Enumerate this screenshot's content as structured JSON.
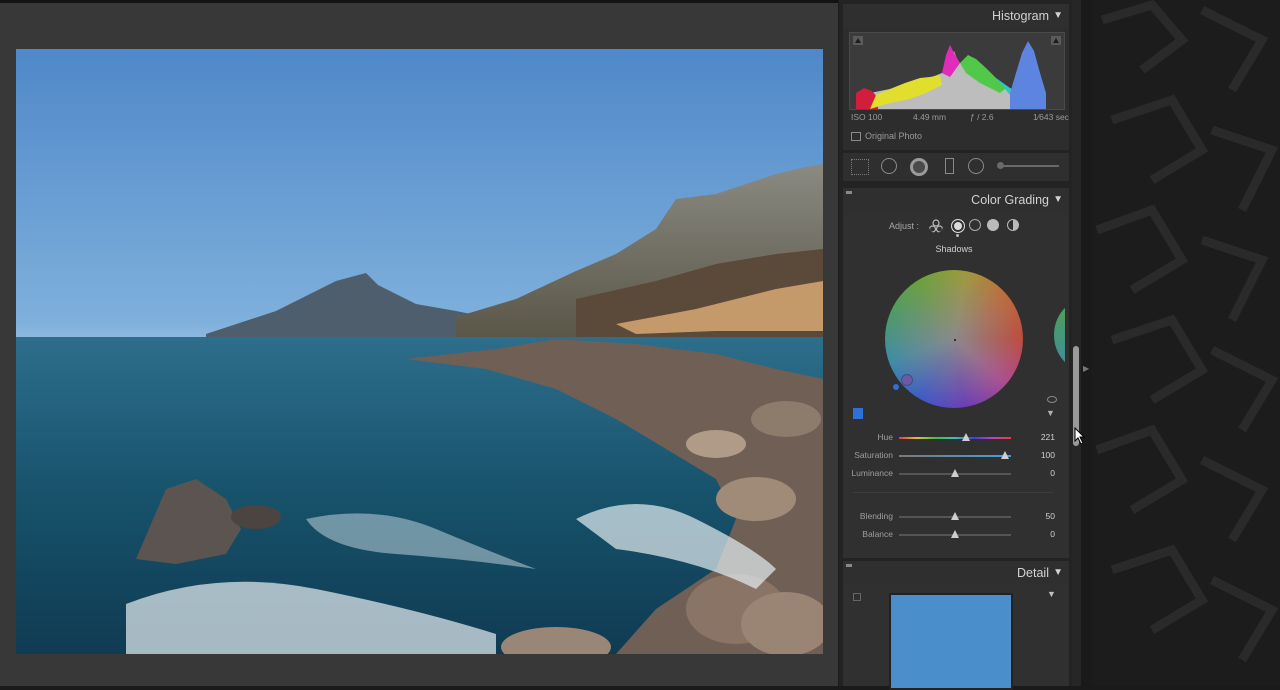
{
  "panel": {
    "histogram": {
      "title": "Histogram",
      "iso": "ISO 100",
      "focal": "4.49 mm",
      "aperture": "ƒ / 2.6",
      "shutter": "1⁄643 sec",
      "original_label": "Original Photo"
    },
    "color_grading": {
      "title": "Color Grading",
      "adjust_label": "Adjust :",
      "wheel_label": "Shadows",
      "sliders": [
        {
          "label": "Hue",
          "value": "221",
          "pos": 0.6
        },
        {
          "label": "Saturation",
          "value": "100",
          "pos": 0.95
        },
        {
          "label": "Luminance",
          "value": "0",
          "pos": 0.5
        }
      ],
      "sliders2": [
        {
          "label": "Blending",
          "value": "50",
          "pos": 0.5
        },
        {
          "label": "Balance",
          "value": "0",
          "pos": 0.5
        }
      ]
    },
    "detail": {
      "title": "Detail"
    }
  },
  "colors": {
    "accent_blue": "#2e6fd8",
    "panel_bg": "#232323",
    "canvas_bg": "#383838"
  },
  "icons": [
    "triangle-down-icon",
    "eye-icon",
    "grid-icon",
    "brush-icon",
    "radial-mask-icon",
    "shape-icon",
    "ring-icon"
  ]
}
